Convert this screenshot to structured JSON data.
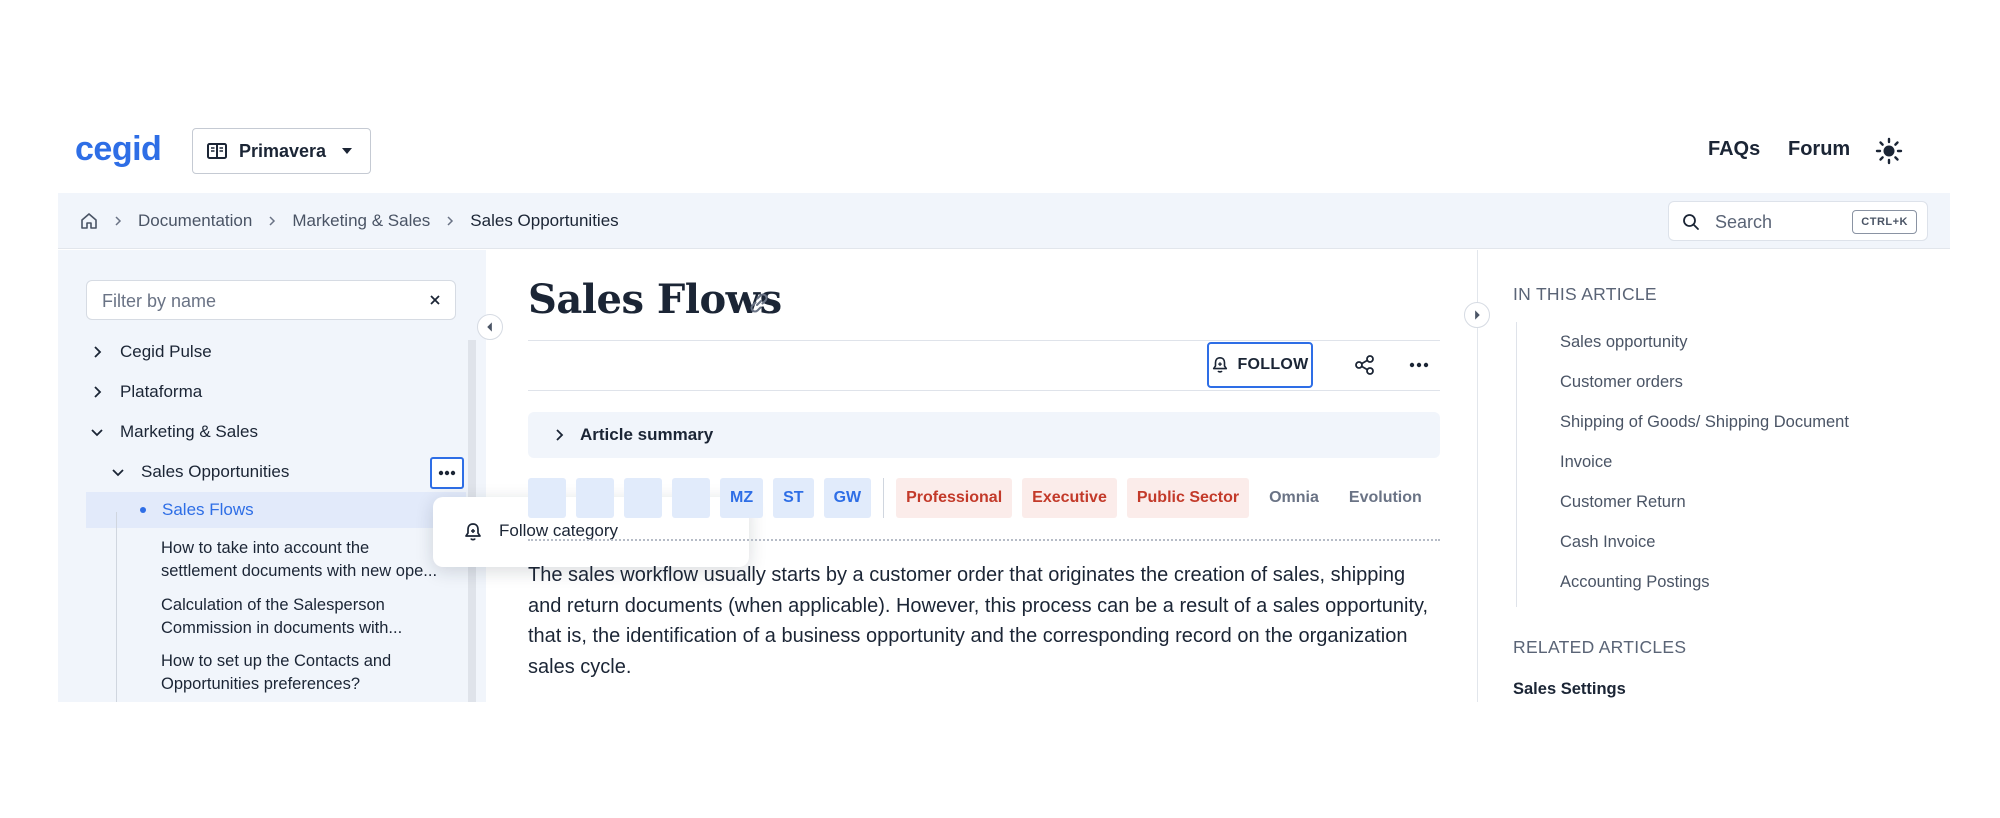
{
  "header": {
    "logo": "cegid",
    "product": "Primavera",
    "links": {
      "faqs": "FAQs",
      "forum": "Forum"
    }
  },
  "breadcrumb": {
    "items": [
      "Documentation",
      "Marketing & Sales",
      "Sales Opportunities"
    ]
  },
  "search": {
    "placeholder": "Search",
    "shortcut": "CTRL+K"
  },
  "sidebar": {
    "filter_placeholder": "Filter by name",
    "tree": [
      {
        "label": "Cegid Pulse",
        "expanded": false
      },
      {
        "label": "Plataforma",
        "expanded": false
      },
      {
        "label": "Marketing & Sales",
        "expanded": true
      },
      {
        "label": "Sales Opportunities",
        "expanded": true
      },
      {
        "label": "Sales Flows",
        "active": true
      }
    ],
    "leaves": [
      {
        "line1": "How to take into account the",
        "line2": "settlement documents with new ope..."
      },
      {
        "line1": "Calculation of the Salesperson",
        "line2": "Commission in documents with..."
      },
      {
        "line1": "How to set up the Contacts and",
        "line2": "Opportunities preferences?"
      }
    ]
  },
  "popup": {
    "item": "Follow category"
  },
  "article": {
    "title": "Sales Flows",
    "follow_label": "FOLLOW",
    "summary_label": "Article summary",
    "tags_blue": [
      "",
      "",
      "",
      "",
      "MZ",
      "ST",
      "GW"
    ],
    "tags_red": [
      "Professional",
      "Executive",
      "Public Sector"
    ],
    "tags_gray": [
      "Omnia",
      "Evolution"
    ],
    "body": "The sales workflow usually starts by a customer order that originates the creation of sales, shipping and return documents (when applicable). However, this process can be a result of a sales opportunity, that is, the identification of a business opportunity and the corresponding record on the organization sales cycle."
  },
  "toc": {
    "heading": "IN THIS ARTICLE",
    "items": [
      "Sales opportunity",
      "Customer orders",
      "Shipping of Goods/ Shipping Document",
      "Invoice",
      "Customer Return",
      "Cash Invoice",
      "Accounting Postings"
    ],
    "related_heading": "RELATED ARTICLES",
    "related_items": [
      "Sales Settings"
    ]
  },
  "colors": {
    "accent": "#2e6ee6",
    "tag_red": "#c33a2a",
    "panel_bg": "#f1f5fb"
  }
}
